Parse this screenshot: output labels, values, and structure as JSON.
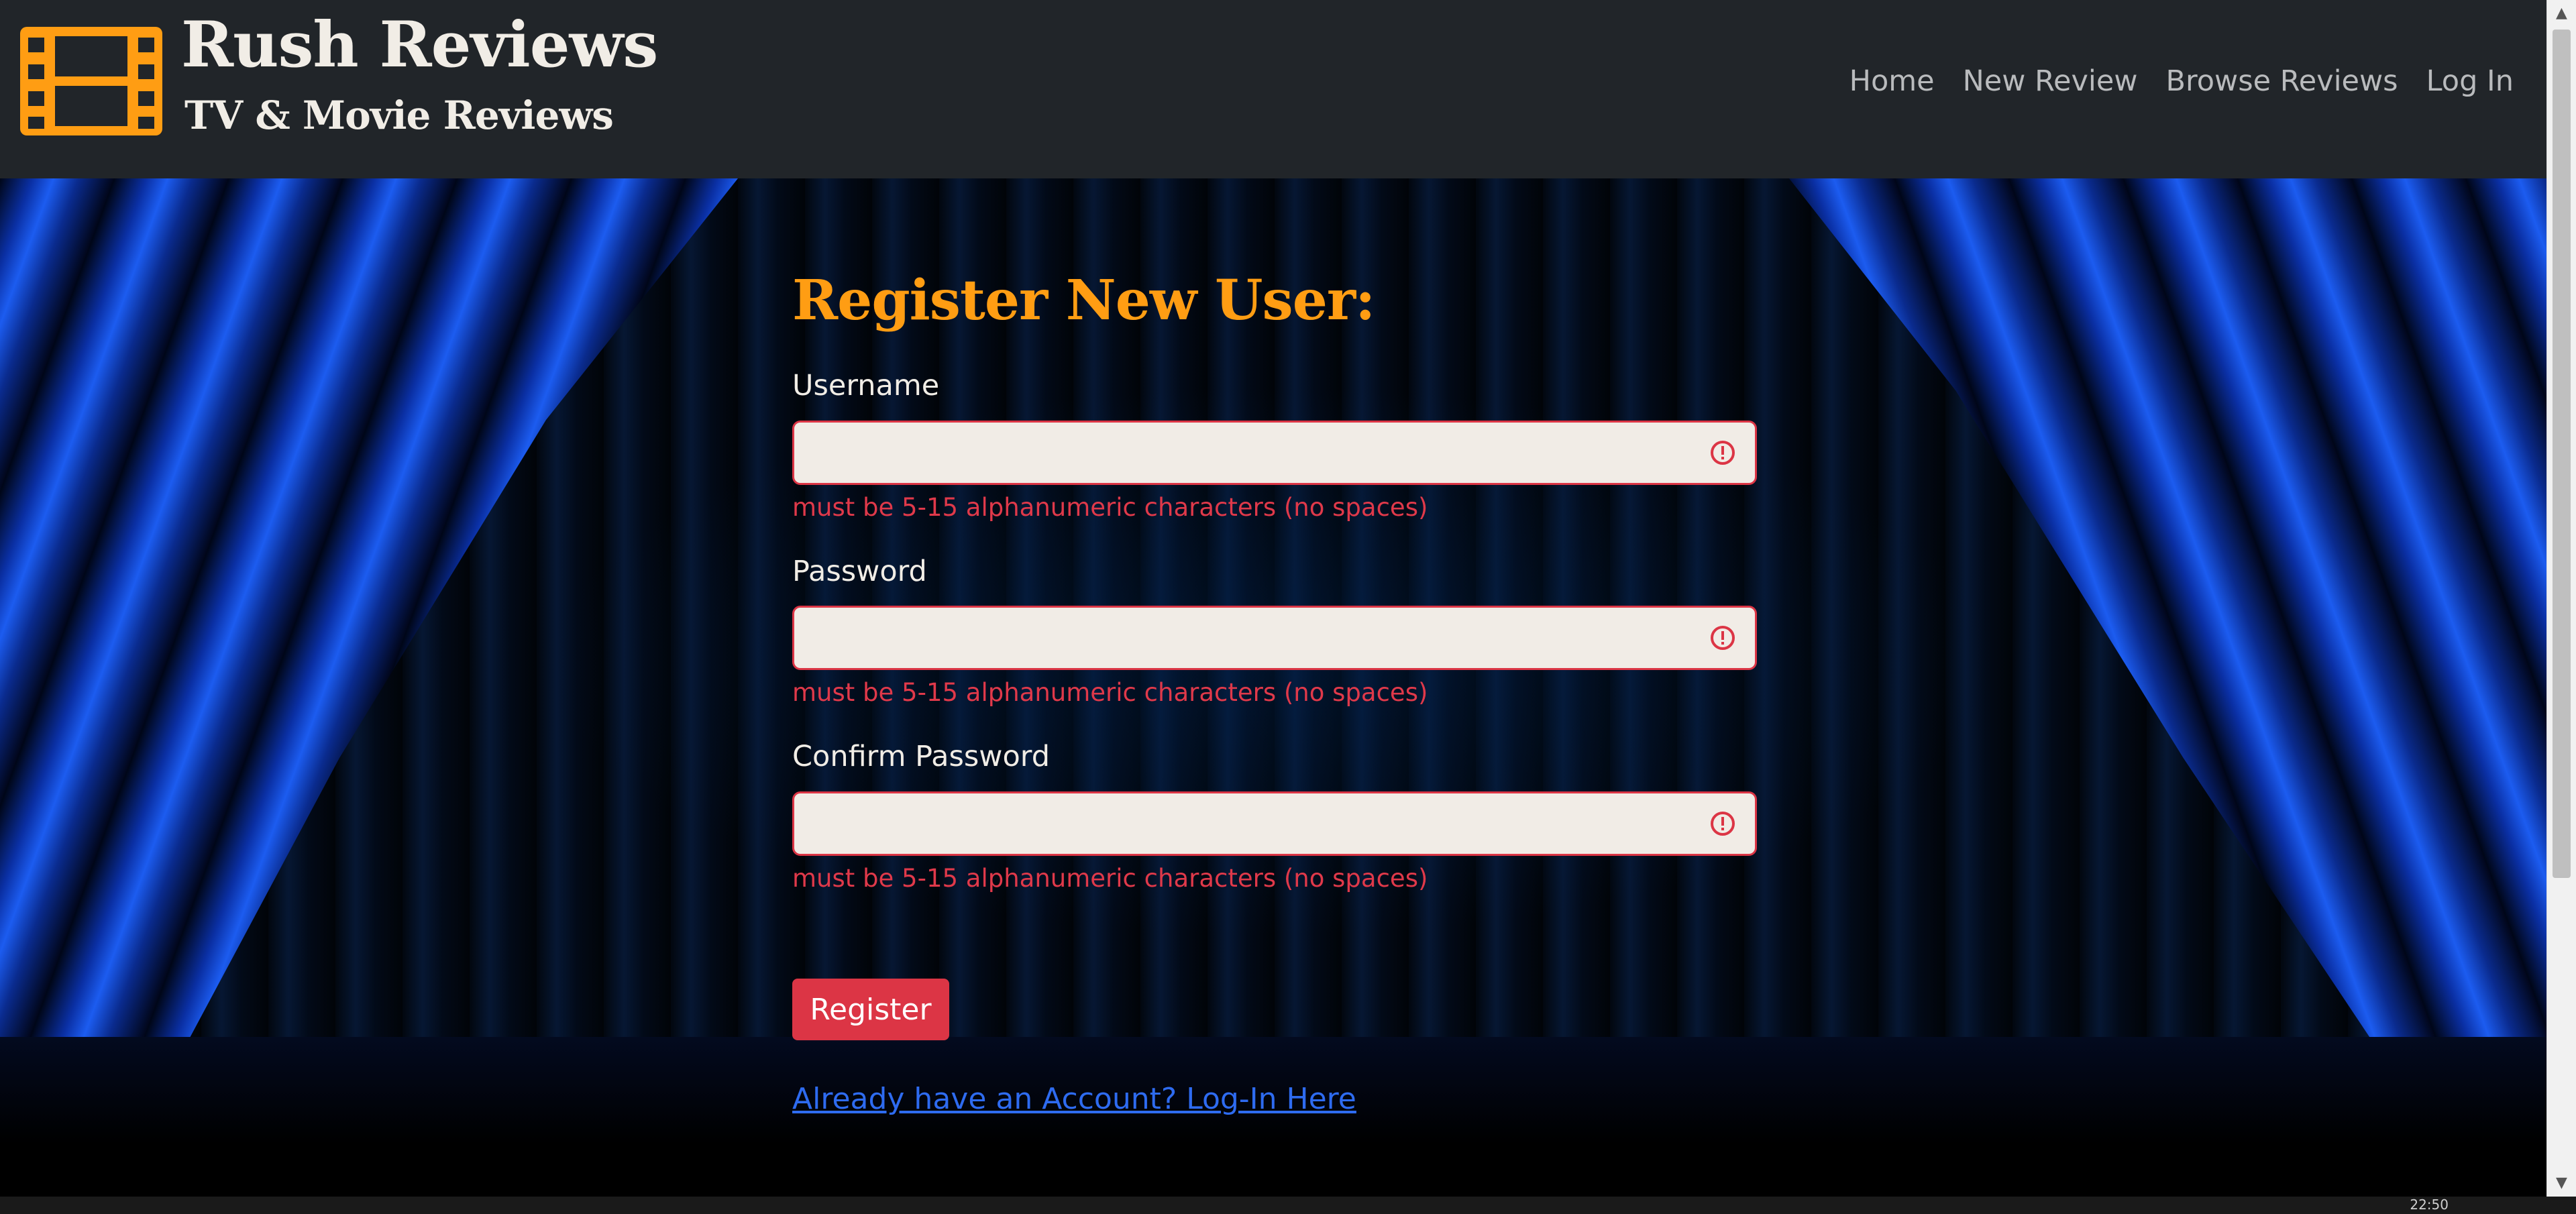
{
  "brand": {
    "title": "Rush Reviews",
    "subtitle": "TV & Movie Reviews",
    "accent_color": "#ff9d13",
    "logo_icon": "film-strip-icon"
  },
  "nav": {
    "items": [
      {
        "label": "Home"
      },
      {
        "label": "New Review"
      },
      {
        "label": "Browse Reviews"
      },
      {
        "label": "Log In"
      }
    ]
  },
  "form": {
    "title": "Register New User:",
    "fields": [
      {
        "label": "Username",
        "value": "",
        "error": "must be 5-15 alphanumeric characters (no spaces)"
      },
      {
        "label": "Password",
        "value": "",
        "error": "must be 5-15 alphanumeric characters (no spaces)"
      },
      {
        "label": "Confirm Password",
        "value": "",
        "error": "must be 5-15 alphanumeric characters (no spaces)"
      }
    ],
    "submit_label": "Register",
    "login_link": "Already have an Account? Log-In Here",
    "error_color": "#dc3545"
  },
  "taskbar": {
    "clock": "22:50"
  }
}
